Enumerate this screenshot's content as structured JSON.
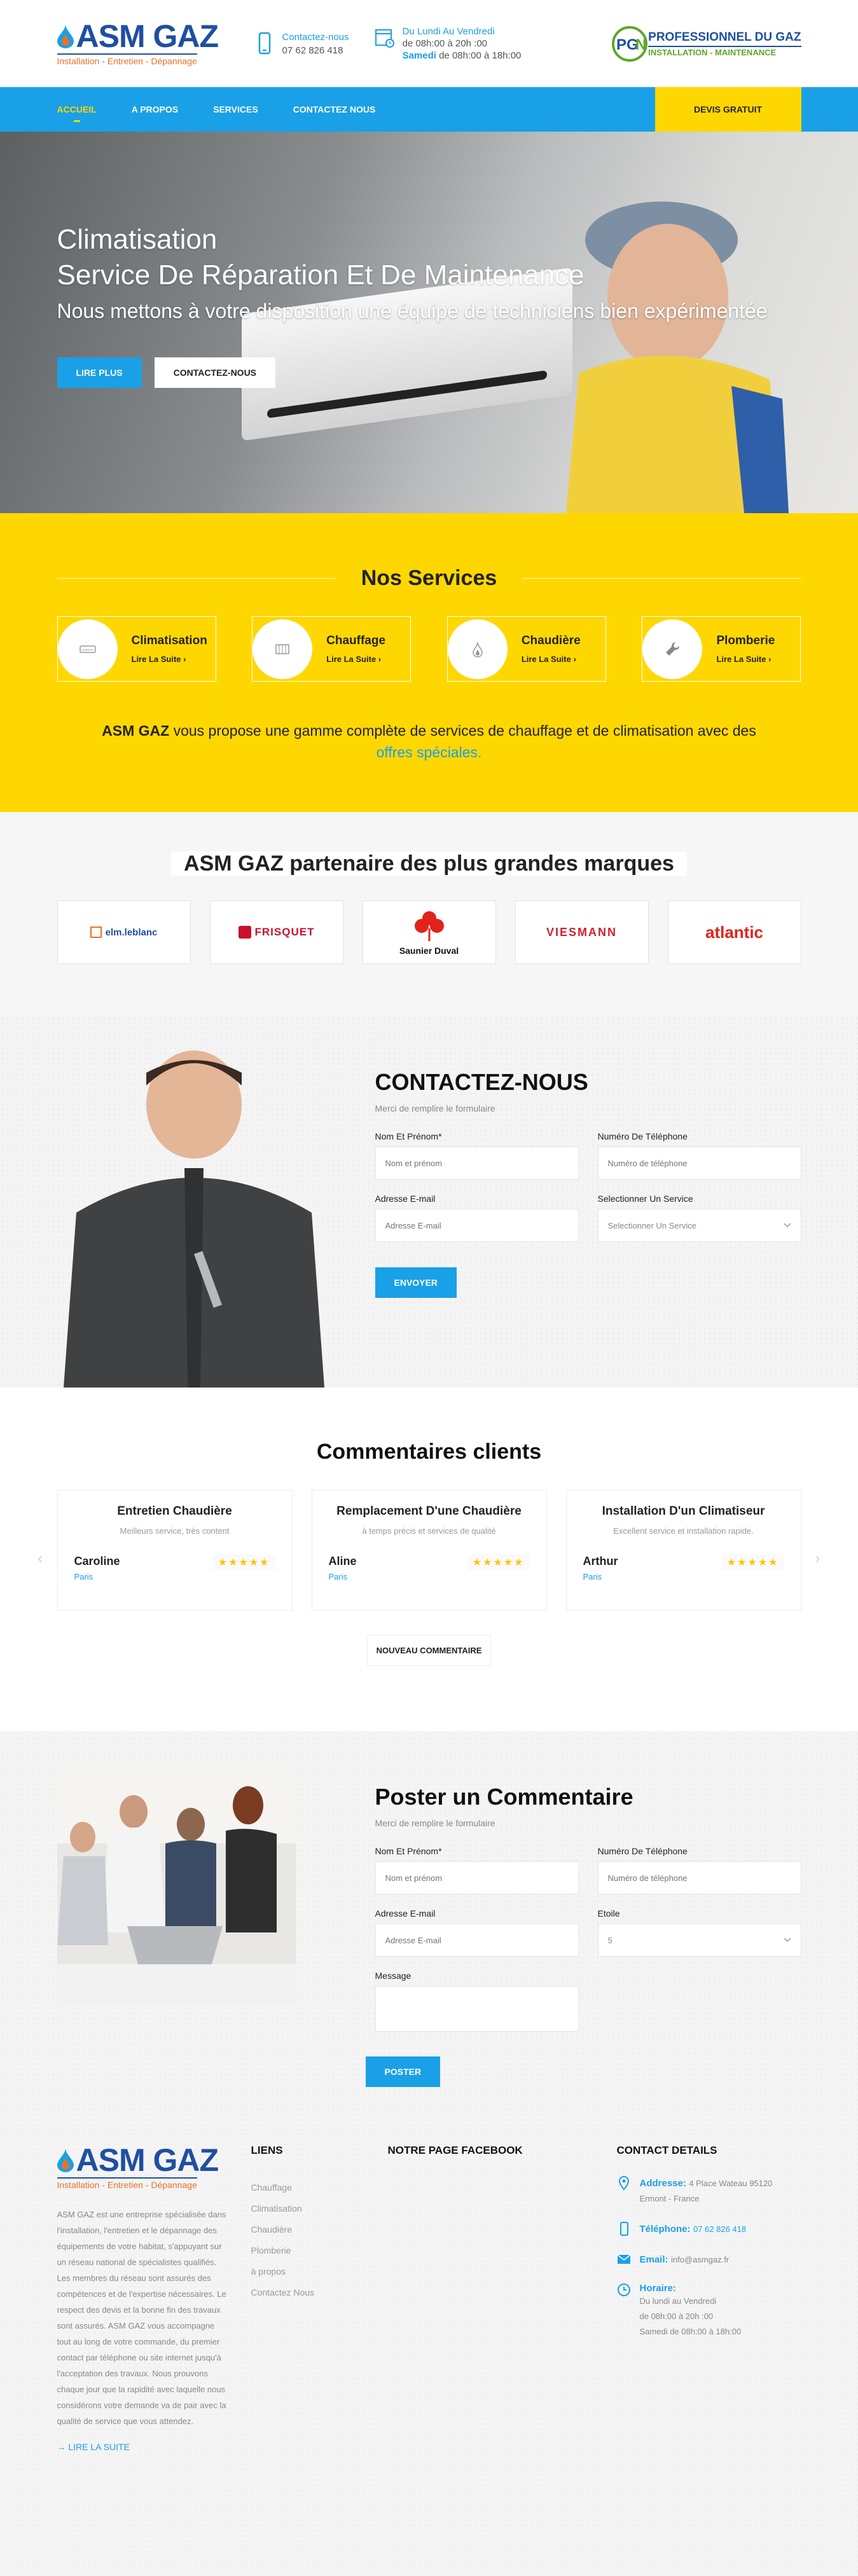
{
  "header": {
    "logo_text": "ASM GAZ",
    "logo_tagline": "Installation - Entretien - Dépannage",
    "contact_label": "Contactez-nous",
    "contact_phone": "07 62 826 418",
    "hours_title": "Du Lundi Au Vendredi",
    "hours_week": "de 08h:00 à 20h :00",
    "hours_sat_label": "Samedi",
    "hours_sat": "de 08h:00 à 18h:00",
    "pgn_title": "PROFESSIONNEL DU GAZ",
    "pgn_sub": "INSTALLATION - MAINTENANCE"
  },
  "nav": {
    "items": [
      "ACCUEIL",
      "A PROPOS",
      "SERVICES",
      "CONTACTEZ NOUS"
    ],
    "cta": "DEVIS GRATUIT"
  },
  "hero": {
    "title_line1": "Climatisation",
    "title_line2": "Service De Réparation Et De Maintenance",
    "subtitle": "Nous mettons à votre disposition une équipe de techniciens bien expérimentée",
    "btn_primary": "LIRE PLUS",
    "btn_secondary": "CONTACTEZ-NOUS"
  },
  "services": {
    "title": "Nos Services",
    "items": [
      {
        "title": "Climatisation",
        "more": "Lire La Suite",
        "icon": "air-conditioner-icon"
      },
      {
        "title": "Chauffage",
        "more": "Lire La Suite",
        "icon": "radiator-icon"
      },
      {
        "title": "Chaudière",
        "more": "Lire La Suite",
        "icon": "flame-icon"
      },
      {
        "title": "Plomberie",
        "more": "Lire La Suite",
        "icon": "wrench-icon"
      }
    ],
    "text_brand": "ASM GAZ",
    "text_body": " vous propose une gamme complète de services de chauffage et de climatisation avec des",
    "text_link": "offres spéciales."
  },
  "partners": {
    "title": "ASM GAZ partenaire des plus grandes marques",
    "brands": [
      "elm.leblanc",
      "FRISQUET",
      "Saunier Duval",
      "VIESMANN",
      "atlantic"
    ]
  },
  "contact": {
    "title": "CONTACTEZ-NOUS",
    "subtitle": "Merci de remplire le formulaire",
    "name_label": "Nom Et Prénom",
    "name_required": "*",
    "name_placeholder": "Nom et prénom",
    "phone_label": "Numéro De Téléphone",
    "phone_placeholder": "Numéro de téléphone",
    "email_label": "Adresse E-mail",
    "email_placeholder": "Adresse E-mail",
    "service_label": "Selectionner Un Service",
    "service_value": "Selectionner Un Service",
    "submit": "ENVOYER"
  },
  "reviews": {
    "title": "Commentaires clients",
    "items": [
      {
        "title": "Entretien Chaudière",
        "text": "Meilleurs service, très content",
        "name": "Caroline",
        "city": "Paris",
        "rating": 5
      },
      {
        "title": "Remplacement D'une Chaudière",
        "text": "à temps précis et services de qualité",
        "name": "Aline",
        "city": "Paris",
        "rating": 5
      },
      {
        "title": "Installation D'un Climatiseur",
        "text": "Excellent service et installation rapide.",
        "name": "Arthur",
        "city": "Paris",
        "rating": 5
      }
    ],
    "stars_text": "★★★★★",
    "prev": "‹",
    "next": "›",
    "new_comment": "NOUVEAU COMMENTAIRE"
  },
  "post_comment": {
    "title": "Poster un Commentaire",
    "subtitle": "Merci de remplire le formulaire",
    "name_label": "Nom Et Prénom",
    "name_required": "*",
    "name_placeholder": "Nom et prénom",
    "phone_label": "Numéro De Téléphone",
    "phone_placeholder": "Numéro de téléphone",
    "email_label": "Adresse E-mail",
    "email_placeholder": "Adresse E-mail",
    "rating_label": "Etoile",
    "rating_value": "5",
    "message_label": "Message",
    "submit": "POSTER"
  },
  "footer": {
    "about": "ASM GAZ est une entreprise spécialisée dans l'installation, l'entretien et le dépannage des équipements de votre habitat, s'appuyant sur un réseau national de spécialistes qualifiés. Les membres du réseau sont assurés des compétences et de l'expertise nécessaires. Le respect des devis et la bonne fin des travaux sont assurés. ASM GAZ vous accompagne tout au long de votre commande, du premier contact par téléphone ou site internet jusqu'à l'acceptation des travaux. Nous prouvons chaque jour que la rapidité avec laquelle nous considérons votre demande va de pair avec la qualité de service que vous attendez.",
    "read_more": "LIRE LA SUITE",
    "links_title": "LIENS",
    "links": [
      "Chauffage",
      "Climatisation",
      "Chaudière",
      "Plomberie",
      "à propos",
      "Contactez Nous"
    ],
    "facebook_title": "NOTRE PAGE FACEBOOK",
    "contact_title": "CONTACT DETAILS",
    "address_label": "Addresse:",
    "address_value": "4 Place Wateau 95120",
    "address_city": "Ermont - France",
    "phone_label": "Téléphone:",
    "phone_value": "07 62 826 418",
    "email_label": "Email:",
    "email_value": "info@asmgaz.fr",
    "hours_label": "Horaire:",
    "hours_1": "Du lundi au Vendredi",
    "hours_2": "de 08h:00 à 20h :00",
    "hours_3": "Samedi de 08h:00 à 18h:00"
  },
  "colors": {
    "primary_blue": "#1aa0e6",
    "yellow": "#ffd700",
    "logo_blue": "#1f4fa1",
    "logo_orange": "#e8712a"
  }
}
